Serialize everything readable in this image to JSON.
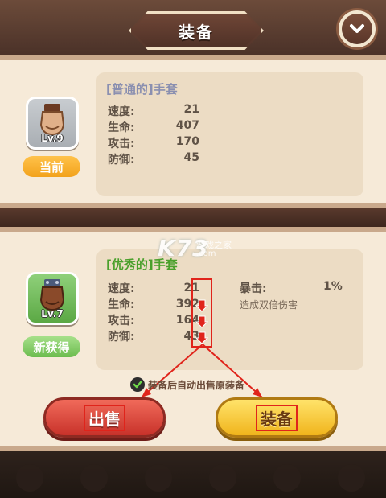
{
  "header": {
    "title": "装备"
  },
  "current_item": {
    "name": "[普通的]手套",
    "level": "Lv.9",
    "tag": "当前",
    "stats": [
      {
        "label": "速度:",
        "value": "21"
      },
      {
        "label": "生命:",
        "value": "407"
      },
      {
        "label": "攻击:",
        "value": "170"
      },
      {
        "label": "防御:",
        "value": "45"
      }
    ]
  },
  "new_item": {
    "name": "[优秀的]手套",
    "level": "Lv.7",
    "tag": "新获得",
    "stats": [
      {
        "label": "速度:",
        "value": "21",
        "down": false
      },
      {
        "label": "生命:",
        "value": "392",
        "down": true
      },
      {
        "label": "攻击:",
        "value": "164",
        "down": true
      },
      {
        "label": "防御:",
        "value": "43",
        "down": true
      }
    ],
    "special": {
      "label": "暴击:",
      "value": "1%",
      "desc": "造成双倍伤害"
    }
  },
  "auto_sell": {
    "text": "装备后自动出售原装备",
    "checked": true
  },
  "buttons": {
    "sell": "出售",
    "equip": "装备"
  },
  "watermark": {
    "logo": "K73",
    "name": "游戏之家",
    "url": ".com"
  },
  "colors": {
    "current_name": "#8a8fb0",
    "new_name": "#4aa02c",
    "down_arrow": "#e0241b",
    "annotation": "#e0241b"
  }
}
